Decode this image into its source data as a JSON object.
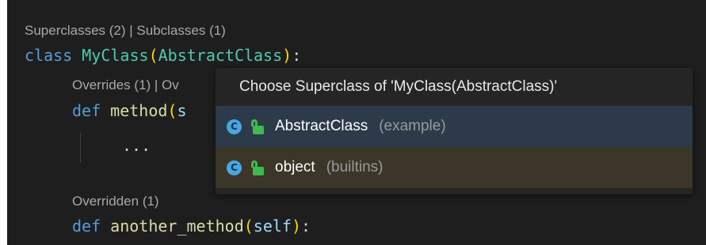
{
  "editor": {
    "lens_class": "Superclasses (2) | Subclasses (1)",
    "class_line": {
      "kw": "class",
      "name": "MyClass",
      "paren_open": "(",
      "base": "AbstractClass",
      "paren_close": ")",
      "colon": ":"
    },
    "lens_method": "Overrides (1) | Ov",
    "method_line": {
      "kw": "def",
      "name": "method",
      "paren_open": "(",
      "param": "s"
    },
    "ellipsis": "...",
    "lens_another": "Overridden (1)",
    "another_line": {
      "kw": "def",
      "name": "another_method",
      "paren_open": "(",
      "param": "self",
      "paren_close": ")",
      "colon": ":"
    }
  },
  "popup": {
    "title": "Choose Superclass of 'MyClass(AbstractClass)'",
    "items": [
      {
        "badge": "C",
        "name": "AbstractClass",
        "module": "(example)",
        "icon": "lock-icon"
      },
      {
        "badge": "C",
        "name": "object",
        "module": "(builtins)",
        "icon": "lock-icon"
      }
    ]
  },
  "colors": {
    "editor_bg": "#1e1e1e",
    "popup_bg": "#252526",
    "selected_bg": "#2c3a4a",
    "keyword": "#569cd6",
    "class_name": "#4ec9b0",
    "function": "#dcdcaa",
    "bracket": "#ffd700",
    "badge": "#4aa6e0",
    "lock": "#3fb950"
  }
}
